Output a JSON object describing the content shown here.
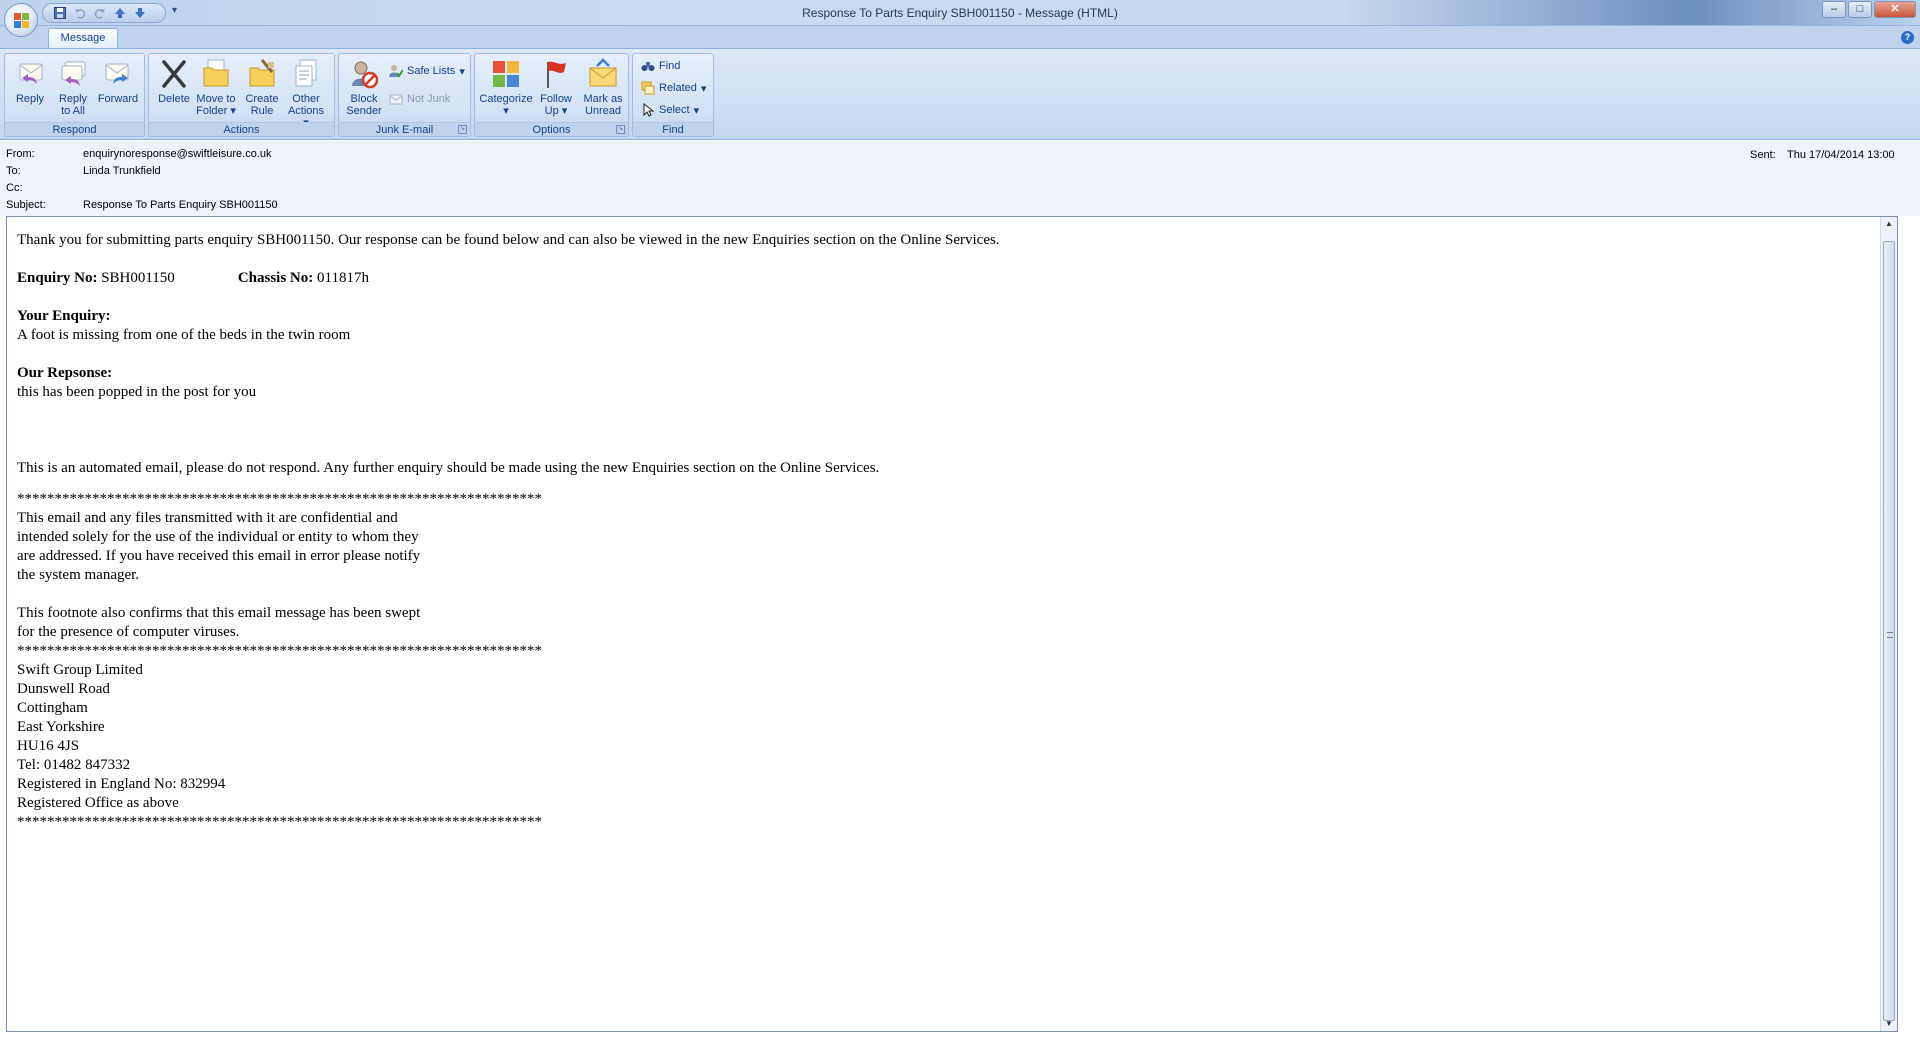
{
  "window": {
    "title": "Response To Parts Enquiry SBH001150 - Message (HTML)",
    "controls": {
      "minimize": "–",
      "maximize": "□",
      "close": "✕"
    }
  },
  "qat": {
    "save": "save-icon",
    "undo": "undo-icon",
    "redo": "redo-icon",
    "prev": "up-arrow-icon",
    "next": "down-arrow-icon",
    "more": "▾"
  },
  "tabs": [
    {
      "label": "Message",
      "active": true
    }
  ],
  "ribbon": {
    "respond": {
      "label": "Respond",
      "reply": "Reply",
      "reply_all_1": "Reply",
      "reply_all_2": "to All",
      "forward": "Forward"
    },
    "actions": {
      "label": "Actions",
      "delete": "Delete",
      "move_1": "Move to",
      "move_2": "Folder",
      "create_1": "Create",
      "create_2": "Rule",
      "other_1": "Other",
      "other_2": "Actions"
    },
    "junk": {
      "label": "Junk E-mail",
      "block_1": "Block",
      "block_2": "Sender",
      "safe_lists": "Safe Lists",
      "not_junk": "Not Junk"
    },
    "options": {
      "label": "Options",
      "categorize": "Categorize",
      "follow_1": "Follow",
      "follow_2": "Up",
      "mark_1": "Mark as",
      "mark_2": "Unread"
    },
    "find": {
      "label": "Find",
      "find": "Find",
      "related": "Related",
      "select": "Select"
    }
  },
  "header": {
    "from_label": "From:",
    "from": "enquirynoresponse@swiftleisure.co.uk",
    "to_label": "To:",
    "to": "Linda Trunkfield",
    "cc_label": "Cc:",
    "cc": "",
    "subject_label": "Subject:",
    "subject": "Response To Parts Enquiry SBH001150",
    "sent_label": "Sent:",
    "sent": "Thu 17/04/2014 13:00"
  },
  "body": {
    "intro": "Thank you for submitting parts enquiry SBH001150. Our response can be found below and can also be viewed in the new Enquiries section on the Online Services.",
    "enquiry_no_label": "Enquiry No:",
    "enquiry_no": "SBH001150",
    "chassis_no_label": "Chassis No:",
    "chassis_no": "011817h",
    "your_enquiry_label": "Your Enquiry:",
    "your_enquiry": "A foot is missing from one of the beds in the twin room",
    "our_response_label": "Our Repsonse:",
    "our_response": "this has been popped in the post for you",
    "automated": "This is an automated email, please do not respond. Any further enquiry should be made using the new Enquiries section on the Online Services.",
    "stars": "**********************************************************************",
    "conf_1": "This email and any files transmitted with it are confidential and",
    "conf_2": "intended solely for the use of the individual or entity to whom they",
    "conf_3": "are addressed. If you have received this email in error please notify",
    "conf_4": "the system manager.",
    "virus_1": "This footnote also confirms that this email message has been swept",
    "virus_2": "for the presence of computer viruses.",
    "address": [
      "Swift Group Limited",
      "Dunswell Road",
      "Cottingham",
      "East Yorkshire",
      "HU16 4JS",
      "Tel: 01482 847332",
      "Registered in England No: 832994",
      "Registered Office as above"
    ]
  }
}
